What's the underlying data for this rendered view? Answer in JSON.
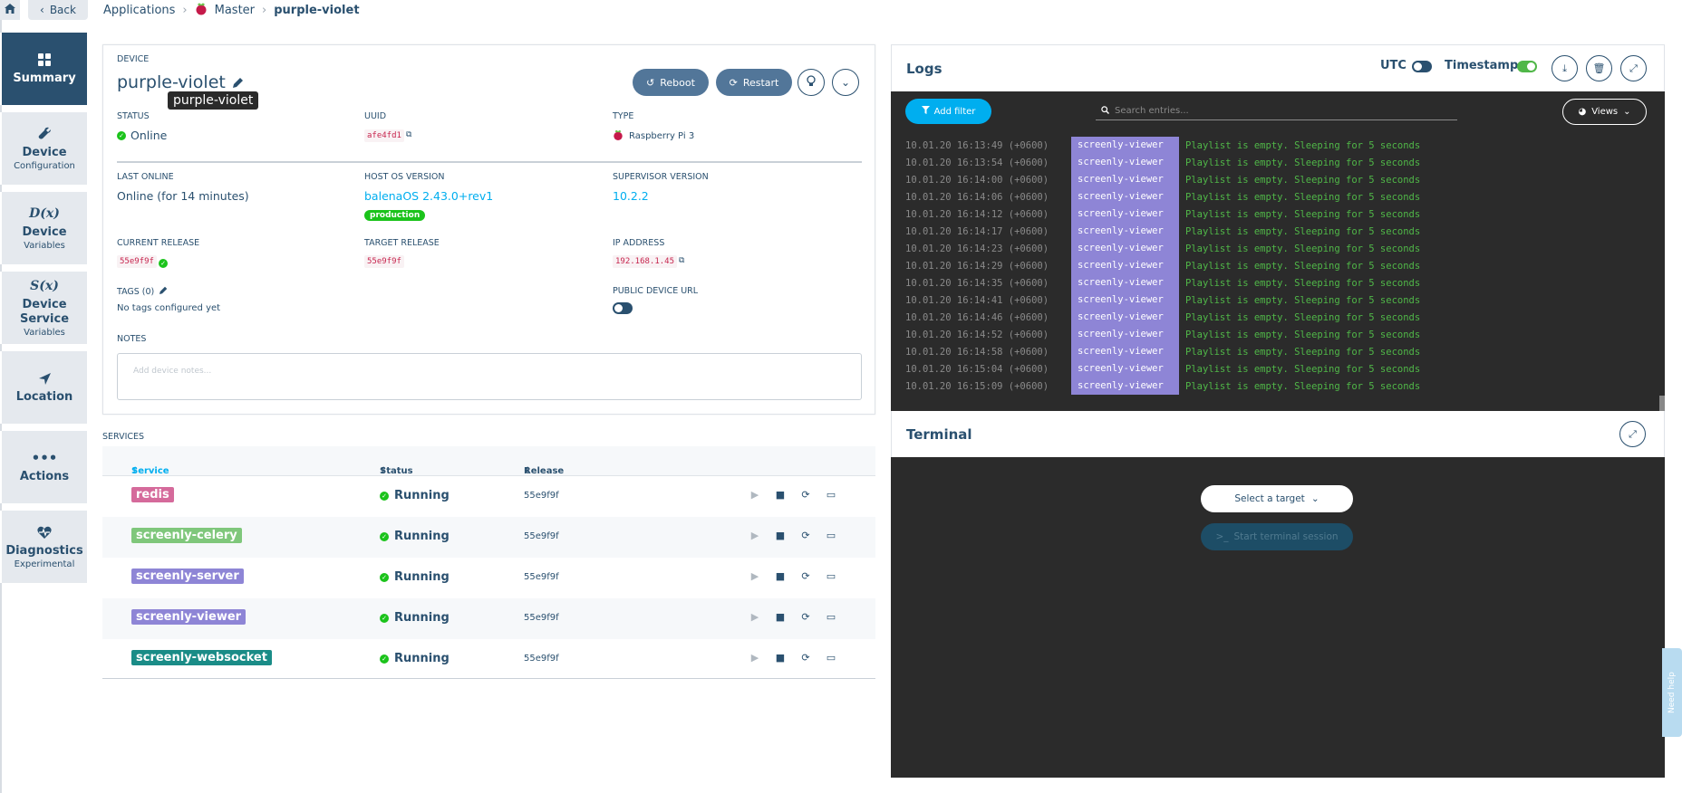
{
  "topbar": {
    "back_label": "Back",
    "breadcrumbs": [
      "Applications",
      "Master",
      "purple-violet"
    ]
  },
  "sidebar": {
    "items": [
      {
        "title": "Summary",
        "subtitle": "",
        "icon": "grid-icon"
      },
      {
        "title": "Device",
        "subtitle": "Configuration",
        "icon": "wrench-icon"
      },
      {
        "title": "Device",
        "subtitle": "Variables",
        "icon": "dx-icon",
        "icon_text": "D(x)"
      },
      {
        "title": "Device Service",
        "subtitle": "Variables",
        "icon": "sx-icon",
        "icon_text": "S(x)"
      },
      {
        "title": "Location",
        "subtitle": "",
        "icon": "location-arrow-icon"
      },
      {
        "title": "Actions",
        "subtitle": "",
        "icon": "ellipsis-icon"
      },
      {
        "title": "Diagnostics",
        "subtitle": "Experimental",
        "icon": "heartbeat-icon"
      }
    ]
  },
  "device": {
    "section_label": "DEVICE",
    "name": "purple-violet",
    "tooltip": "purple-violet",
    "reboot_label": "Reboot",
    "restart_label": "Restart",
    "status_label": "STATUS",
    "status_value": "Online",
    "uuid_label": "UUID",
    "uuid_value": "afe4fd1",
    "type_label": "TYPE",
    "type_value": "Raspberry Pi 3",
    "last_online_label": "LAST ONLINE",
    "last_online_value": "Online (for 14 minutes)",
    "host_os_label": "HOST OS VERSION",
    "host_os_value": "balenaOS 2.43.0+rev1",
    "host_os_badge": "production",
    "supervisor_label": "SUPERVISOR VERSION",
    "supervisor_value": "10.2.2",
    "current_release_label": "CURRENT RELEASE",
    "current_release_value": "55e9f9f",
    "target_release_label": "TARGET RELEASE",
    "target_release_value": "55e9f9f",
    "ip_label": "IP ADDRESS",
    "ip_value": "192.168.1.45",
    "tags_label": "TAGS (0)",
    "tags_value": "No tags configured yet",
    "public_url_label": "PUBLIC DEVICE URL",
    "notes_label": "NOTES",
    "notes_placeholder": "Add device notes..."
  },
  "services": {
    "label": "SERVICES",
    "headers": [
      "Service",
      "Status",
      "Release"
    ],
    "rows": [
      {
        "name": "redis",
        "color": "#d56a9b",
        "status": "Running",
        "release": "55e9f9f"
      },
      {
        "name": "screenly-celery",
        "color": "#7fc77b",
        "status": "Running",
        "release": "55e9f9f"
      },
      {
        "name": "screenly-server",
        "color": "#8e85d6",
        "status": "Running",
        "release": "55e9f9f"
      },
      {
        "name": "screenly-viewer",
        "color": "#8e85d6",
        "status": "Running",
        "release": "55e9f9f"
      },
      {
        "name": "screenly-websocket",
        "color": "#1a8c87",
        "status": "Running",
        "release": "55e9f9f"
      }
    ]
  },
  "logs": {
    "title": "Logs",
    "utc_label": "UTC",
    "timestamps_label": "Timestamps",
    "add_filter_label": "Add filter",
    "search_placeholder": "Search entries...",
    "views_label": "Views",
    "lines": [
      {
        "ts": "10.01.20 16:13:49 (+0600)",
        "service": "screenly-viewer",
        "msg": "Playlist is empty. Sleeping for 5 seconds"
      },
      {
        "ts": "10.01.20 16:13:54 (+0600)",
        "service": "screenly-viewer",
        "msg": "Playlist is empty. Sleeping for 5 seconds"
      },
      {
        "ts": "10.01.20 16:14:00 (+0600)",
        "service": "screenly-viewer",
        "msg": "Playlist is empty. Sleeping for 5 seconds"
      },
      {
        "ts": "10.01.20 16:14:06 (+0600)",
        "service": "screenly-viewer",
        "msg": "Playlist is empty. Sleeping for 5 seconds"
      },
      {
        "ts": "10.01.20 16:14:12 (+0600)",
        "service": "screenly-viewer",
        "msg": "Playlist is empty. Sleeping for 5 seconds"
      },
      {
        "ts": "10.01.20 16:14:17 (+0600)",
        "service": "screenly-viewer",
        "msg": "Playlist is empty. Sleeping for 5 seconds"
      },
      {
        "ts": "10.01.20 16:14:23 (+0600)",
        "service": "screenly-viewer",
        "msg": "Playlist is empty. Sleeping for 5 seconds"
      },
      {
        "ts": "10.01.20 16:14:29 (+0600)",
        "service": "screenly-viewer",
        "msg": "Playlist is empty. Sleeping for 5 seconds"
      },
      {
        "ts": "10.01.20 16:14:35 (+0600)",
        "service": "screenly-viewer",
        "msg": "Playlist is empty. Sleeping for 5 seconds"
      },
      {
        "ts": "10.01.20 16:14:41 (+0600)",
        "service": "screenly-viewer",
        "msg": "Playlist is empty. Sleeping for 5 seconds"
      },
      {
        "ts": "10.01.20 16:14:46 (+0600)",
        "service": "screenly-viewer",
        "msg": "Playlist is empty. Sleeping for 5 seconds"
      },
      {
        "ts": "10.01.20 16:14:52 (+0600)",
        "service": "screenly-viewer",
        "msg": "Playlist is empty. Sleeping for 5 seconds"
      },
      {
        "ts": "10.01.20 16:14:58 (+0600)",
        "service": "screenly-viewer",
        "msg": "Playlist is empty. Sleeping for 5 seconds"
      },
      {
        "ts": "10.01.20 16:15:04 (+0600)",
        "service": "screenly-viewer",
        "msg": "Playlist is empty. Sleeping for 5 seconds"
      },
      {
        "ts": "10.01.20 16:15:09 (+0600)",
        "service": "screenly-viewer",
        "msg": "Playlist is empty. Sleeping for 5 seconds"
      }
    ]
  },
  "terminal": {
    "title": "Terminal",
    "select_target_label": "Select a target",
    "start_session_label": "Start terminal session"
  },
  "help": {
    "label": "Need help"
  }
}
